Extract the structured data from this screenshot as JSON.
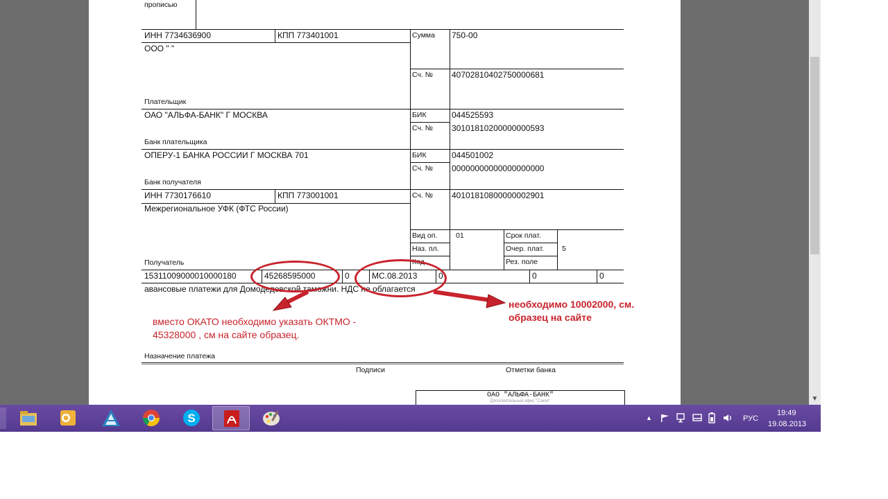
{
  "document": {
    "propisyu": "прописью",
    "payer_inn": "ИНН 7734636900",
    "payer_kpp": "КПП 773401001",
    "payer_name": "ООО \"                    \"",
    "payer_label": "Плательщик",
    "sum_label": "Сумма",
    "sum_value": "750-00",
    "acc_label": "Сч. №",
    "payer_account": "40702810402750000681",
    "payer_bank": "ОАО \"АЛЬФА-БАНК\"  Г МОСКВА",
    "payer_bank_label": "Банк плательщика",
    "bik_label": "БИК",
    "payer_bank_bik": "044525593",
    "payer_bank_corr": "30101810200000000593",
    "receiver_bank": "ОПЕРУ-1 БАНКА РОССИИ  Г МОСКВА 701",
    "receiver_bank_label": "Банк получателя",
    "receiver_bank_bik": "044501002",
    "receiver_bank_corr": "00000000000000000000",
    "receiver_inn": "ИНН 7730176610",
    "receiver_kpp": "КПП 773001001",
    "receiver_account": "40101810800000002901",
    "receiver_name": "Межрегиональное УФК (ФТС России)",
    "receiver_label": "Получатель",
    "vid_op_label": "Вид оп.",
    "vid_op_value": "01",
    "naz_pl_label": "Наз. пл.",
    "kod_label": "Код",
    "srok_label": "Срок плат.",
    "ocher_label": "Очер. плат.",
    "ocher_value": "5",
    "rez_label": "Рез. поле",
    "kbk": "15311009000010000180",
    "okato": "45268595000",
    "field_106": "0",
    "field_107": "МС.08.2013",
    "field_108": "0",
    "field_109": "0",
    "field_110": "0",
    "purpose_text": "авансовые платежи для Домодедовской таможни. НДС не облагается",
    "purpose_label": "Назначение платежа",
    "signatures_label": "Подписи",
    "bank_marks_label": "Отметки банка",
    "stamp_title": "ОАО \"АЛЬФА-БАНК\"",
    "stamp_sub": "Дополнительный офис \"Сокол\""
  },
  "annotations": {
    "note_oktmo_line1": "вместо ОКАТО необходимо указать ОКТМО -",
    "note_oktmo_line2": "45328000 , см на сайте образец.",
    "note_period_line1": "необходимо 10002000, см.",
    "note_period_line2": "образец  на сайте",
    "color": "#c8232c"
  },
  "taskbar": {
    "apps": [
      "file-explorer",
      "outlook",
      "app-a",
      "chrome",
      "skype",
      "acrobat-reader",
      "paint"
    ],
    "language": "РУС",
    "time": "19:49",
    "date": "19.08.2013",
    "accent": "#5a3f96"
  }
}
